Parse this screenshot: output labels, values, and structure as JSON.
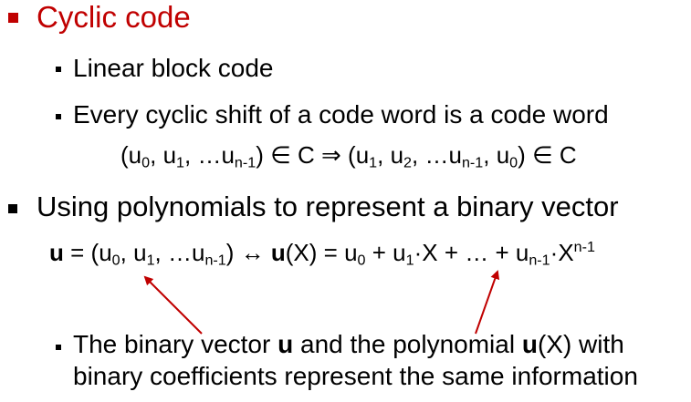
{
  "heading": {
    "text": "Cyclic code"
  },
  "items": [
    {
      "text": "Linear block code"
    },
    {
      "text": "Every cyclic shift of a code word is a code word"
    }
  ],
  "shift_formula": {
    "u": "u",
    "c": "C",
    "comma": ", ",
    "ellipsis": "…",
    "elem": " ∈ ",
    "implies": " ⇒ ",
    "open": "(",
    "close": ")",
    "s0": "0",
    "s1": "1",
    "s2": "2",
    "sn1": "n-1"
  },
  "heading2": {
    "text": "Using polynomials to represent a binary vector"
  },
  "poly_formula": {
    "bold_u": "u",
    "eq": " = ",
    "u": "u",
    "comma": ", ",
    "ellipsis": "…",
    "open": "(",
    "close": ")",
    "biarrow": " ↔ ",
    "openx": "(X)",
    "plus": " + ",
    "dot": "·",
    "x": "X",
    "plus_dots": " + … + ",
    "s0": "0",
    "s1": "1",
    "sn1": "n-1"
  },
  "note": {
    "line1_a": "The binary vector ",
    "bold_u": "u",
    "line1_b": " and the polynomial ",
    "bold_u2": "u",
    "line1_c": "(X) with",
    "line2": "binary coefficients represent the same information"
  },
  "colors": {
    "accent": "#c00000",
    "text": "#000000",
    "bullet_red": "#c00000"
  }
}
